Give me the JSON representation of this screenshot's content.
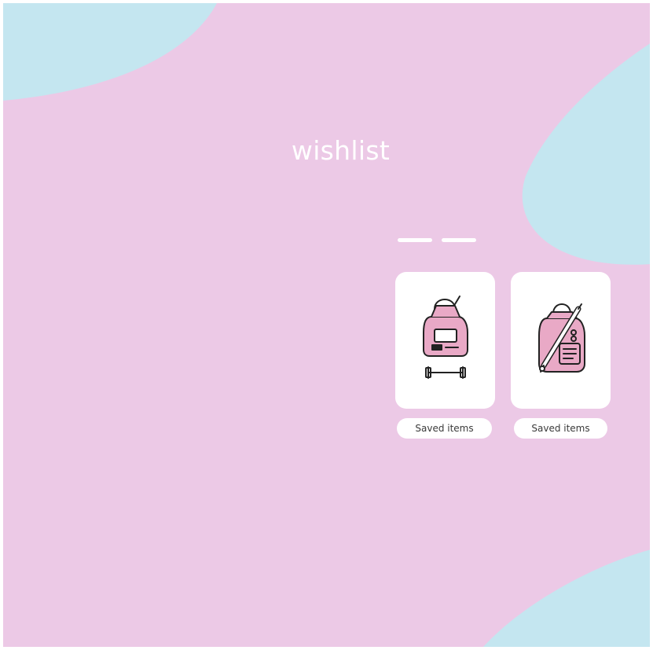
{
  "header": {
    "title": "wishlist"
  },
  "carousel": {
    "page_count": 2,
    "items": [
      {
        "label": "Saved items",
        "icon": "backpack-dumbbell-icon"
      },
      {
        "label": "Saved items",
        "icon": "backpack-pencil-icon"
      }
    ]
  },
  "colors": {
    "background": "#ecc9e6",
    "blob": "#c4e6f0",
    "card": "#ffffff",
    "icon_fill": "#e9a9c6",
    "icon_stroke": "#222222"
  }
}
